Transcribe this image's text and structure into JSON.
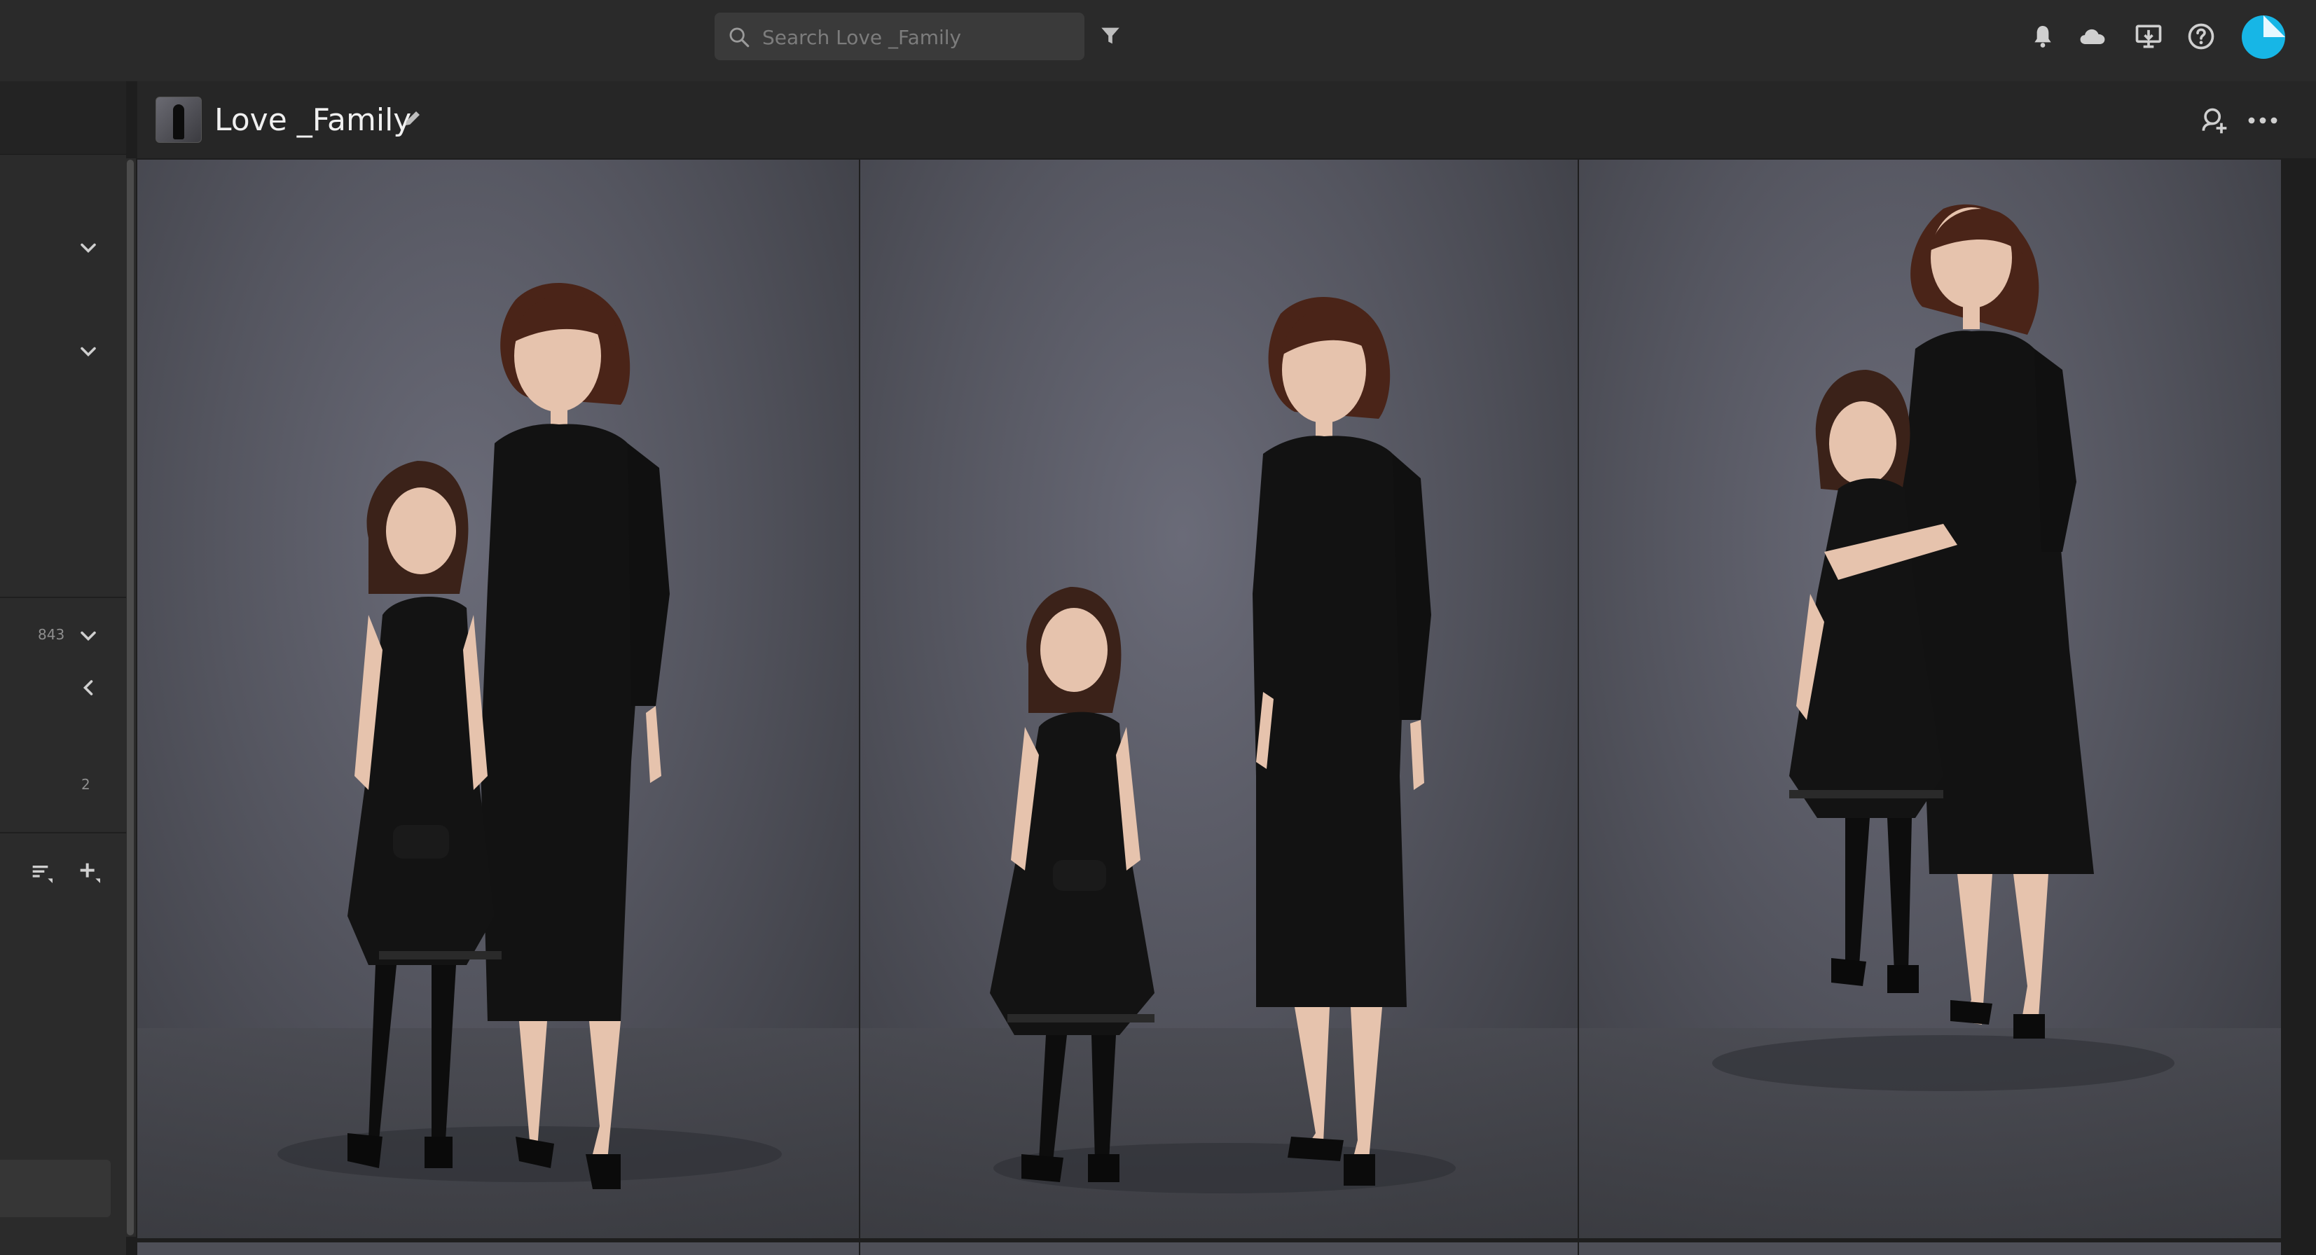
{
  "search": {
    "placeholder": "Search Love _Family"
  },
  "album": {
    "title": "Love _Family"
  },
  "sidebar": {
    "count": "843",
    "sub_count": "2"
  },
  "icons": {
    "search": "search-icon",
    "filter": "filter-icon",
    "notifications": "bell-icon",
    "cloud": "cloud-icon",
    "import": "import-icon",
    "help": "help-icon",
    "share": "share-person-icon",
    "more": "more-horizontal-icon",
    "edit": "pencil-icon",
    "sort": "sort-icon",
    "add": "add-icon"
  },
  "colors": {
    "accent": "#17b6e6",
    "background": "#1e1e1e",
    "topbar": "#2a2a2a"
  },
  "photos": [
    {
      "name": "photo-1",
      "alt": ""
    },
    {
      "name": "photo-2",
      "alt": ""
    },
    {
      "name": "photo-3",
      "alt": ""
    }
  ]
}
